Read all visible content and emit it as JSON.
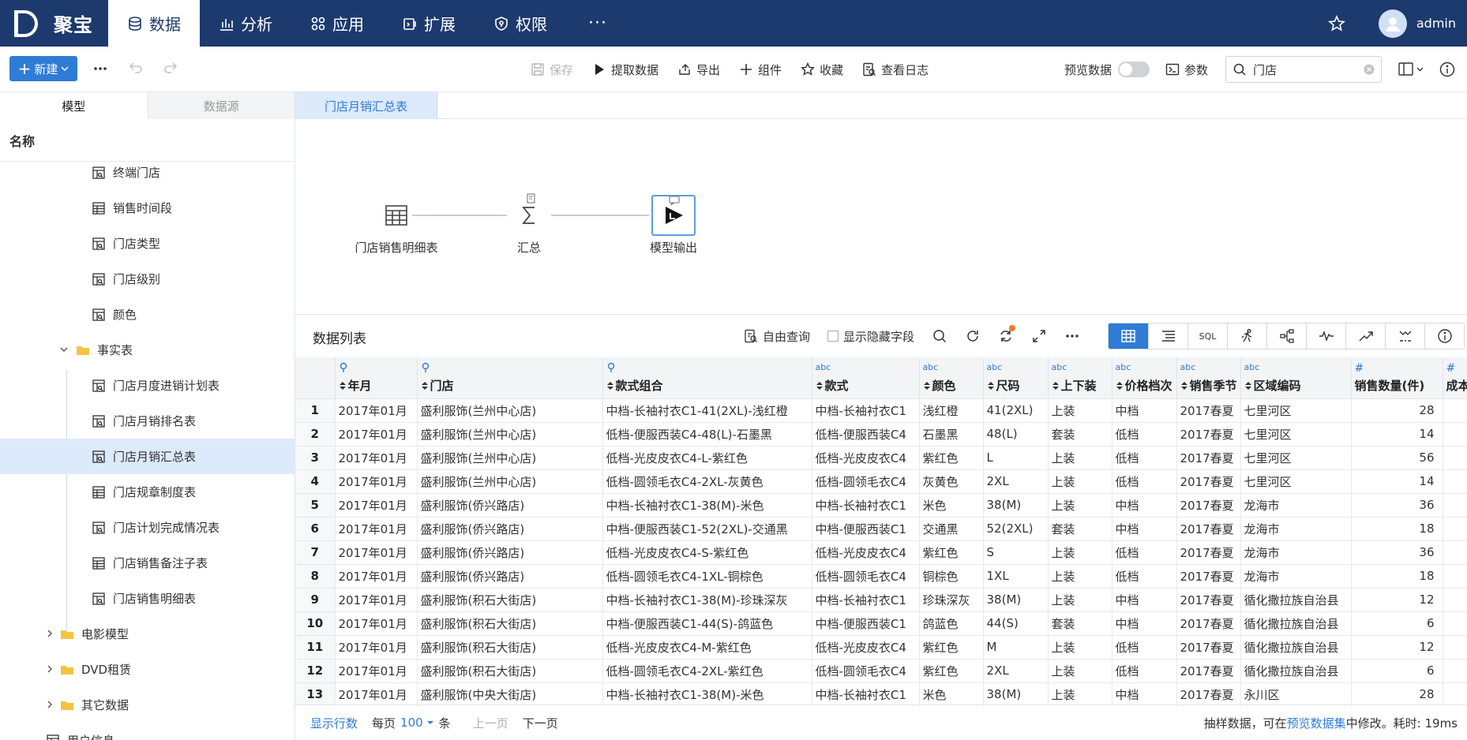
{
  "app": {
    "logo_letter": "D",
    "name": "聚宝",
    "user": "admin"
  },
  "nav": [
    {
      "label": "数据",
      "icon": "database-icon",
      "active": true
    },
    {
      "label": "分析",
      "icon": "bar-chart-icon"
    },
    {
      "label": "应用",
      "icon": "apps-icon"
    },
    {
      "label": "扩展",
      "icon": "extension-icon"
    },
    {
      "label": "权限",
      "icon": "shield-icon"
    },
    {
      "label": "···",
      "icon": "more-icon"
    }
  ],
  "toolbar": {
    "new_label": "新建",
    "save": "保存",
    "extract": "提取数据",
    "export": "导出",
    "component": "组件",
    "favorite": "收藏",
    "log": "查看日志",
    "preview_label": "预览数据",
    "params": "参数",
    "search_value": "门店"
  },
  "sidebar": {
    "tabs": [
      "模型",
      "数据源"
    ],
    "header": "名称",
    "items": [
      {
        "label": "终端门店",
        "icon": "table-model-icon"
      },
      {
        "label": "销售时间段",
        "icon": "table-icon"
      },
      {
        "label": "门店类型",
        "icon": "table-model-icon"
      },
      {
        "label": "门店级别",
        "icon": "table-model-icon"
      },
      {
        "label": "颜色",
        "icon": "table-model-icon"
      },
      {
        "label": "事实表",
        "icon": "folder-icon",
        "folder": true
      },
      {
        "label": "门店月度进销计划表",
        "icon": "table-model-icon"
      },
      {
        "label": "门店月销排名表",
        "icon": "table-model-icon"
      },
      {
        "label": "门店月销汇总表",
        "icon": "table-model-icon",
        "selected": true
      },
      {
        "label": "门店规章制度表",
        "icon": "table-icon"
      },
      {
        "label": "门店计划完成情况表",
        "icon": "table-model-icon"
      },
      {
        "label": "门店销售备注子表",
        "icon": "table-icon"
      },
      {
        "label": "门店销售明细表",
        "icon": "table-model-icon"
      },
      {
        "label": "电影模型",
        "icon": "folder-icon",
        "folder": true
      },
      {
        "label": "DVD租赁",
        "icon": "folder-icon",
        "folder": true
      },
      {
        "label": "其它数据",
        "icon": "folder-icon",
        "folder": true
      },
      {
        "label": "用户信息",
        "icon": "table-icon"
      }
    ]
  },
  "doc_tab": "门店月销汇总表",
  "flow": {
    "source": "门店销售明细表",
    "aggregate": "汇总",
    "output": "模型输出"
  },
  "datalist": {
    "title": "数据列表",
    "free_query": "自由查询",
    "show_hidden": "显示隐藏字段",
    "sql_label": "SQL"
  },
  "table": {
    "columns": [
      {
        "label": "年月",
        "type": "dim-icon"
      },
      {
        "label": "门店",
        "type": "dim-icon"
      },
      {
        "label": "款式组合",
        "type": "dim-icon"
      },
      {
        "label": "款式",
        "type": "abc"
      },
      {
        "label": "颜色",
        "type": "abc"
      },
      {
        "label": "尺码",
        "type": "abc"
      },
      {
        "label": "上下装",
        "type": "abc"
      },
      {
        "label": "价格档次",
        "type": "abc"
      },
      {
        "label": "销售季节",
        "type": "abc"
      },
      {
        "label": "区域编码",
        "type": "abc"
      },
      {
        "label": "销售数量(件)",
        "type": "#"
      },
      {
        "label": "成本",
        "type": "#"
      }
    ],
    "rows": [
      [
        "1",
        "2017年01月",
        "盛利服饰(兰州中心店)",
        "中档-长袖衬衣C1-41(2XL)-浅红橙",
        "中档-长袖衬衣C1",
        "浅红橙",
        "41(2XL)",
        "上装",
        "中档",
        "2017春夏",
        "七里河区",
        "28"
      ],
      [
        "2",
        "2017年01月",
        "盛利服饰(兰州中心店)",
        "低档-便服西装C4-48(L)-石墨黑",
        "低档-便服西装C4",
        "石墨黑",
        "48(L)",
        "套装",
        "低档",
        "2017春夏",
        "七里河区",
        "14"
      ],
      [
        "3",
        "2017年01月",
        "盛利服饰(兰州中心店)",
        "低档-光皮皮衣C4-L-紫红色",
        "低档-光皮皮衣C4",
        "紫红色",
        "L",
        "上装",
        "低档",
        "2017春夏",
        "七里河区",
        "56"
      ],
      [
        "4",
        "2017年01月",
        "盛利服饰(兰州中心店)",
        "低档-圆领毛衣C4-2XL-灰黄色",
        "低档-圆领毛衣C4",
        "灰黄色",
        "2XL",
        "上装",
        "低档",
        "2017春夏",
        "七里河区",
        "14"
      ],
      [
        "5",
        "2017年01月",
        "盛利服饰(侨兴路店)",
        "中档-长袖衬衣C1-38(M)-米色",
        "中档-长袖衬衣C1",
        "米色",
        "38(M)",
        "上装",
        "中档",
        "2017春夏",
        "龙海市",
        "36"
      ],
      [
        "6",
        "2017年01月",
        "盛利服饰(侨兴路店)",
        "中档-便服西装C1-52(2XL)-交通黑",
        "中档-便服西装C1",
        "交通黑",
        "52(2XL)",
        "套装",
        "中档",
        "2017春夏",
        "龙海市",
        "18"
      ],
      [
        "7",
        "2017年01月",
        "盛利服饰(侨兴路店)",
        "低档-光皮皮衣C4-S-紫红色",
        "低档-光皮皮衣C4",
        "紫红色",
        "S",
        "上装",
        "低档",
        "2017春夏",
        "龙海市",
        "36"
      ],
      [
        "8",
        "2017年01月",
        "盛利服饰(侨兴路店)",
        "低档-圆领毛衣C4-1XL-铜棕色",
        "低档-圆领毛衣C4",
        "铜棕色",
        "1XL",
        "上装",
        "低档",
        "2017春夏",
        "龙海市",
        "18"
      ],
      [
        "9",
        "2017年01月",
        "盛利服饰(积石大街店)",
        "中档-长袖衬衣C1-38(M)-珍珠深灰",
        "中档-长袖衬衣C1",
        "珍珠深灰",
        "38(M)",
        "上装",
        "中档",
        "2017春夏",
        "循化撒拉族自治县",
        "12"
      ],
      [
        "10",
        "2017年01月",
        "盛利服饰(积石大街店)",
        "中档-便服西装C1-44(S)-鸽蓝色",
        "中档-便服西装C1",
        "鸽蓝色",
        "44(S)",
        "套装",
        "中档",
        "2017春夏",
        "循化撒拉族自治县",
        "6"
      ],
      [
        "11",
        "2017年01月",
        "盛利服饰(积石大街店)",
        "低档-光皮皮衣C4-M-紫红色",
        "低档-光皮皮衣C4",
        "紫红色",
        "M",
        "上装",
        "低档",
        "2017春夏",
        "循化撒拉族自治县",
        "12"
      ],
      [
        "12",
        "2017年01月",
        "盛利服饰(积石大街店)",
        "低档-圆领毛衣C4-2XL-紫红色",
        "低档-圆领毛衣C4",
        "紫红色",
        "2XL",
        "上装",
        "低档",
        "2017春夏",
        "循化撒拉族自治县",
        "6"
      ],
      [
        "13",
        "2017年01月",
        "盛利服饰(中央大街店)",
        "中档-长袖衬衣C1-38(M)-米色",
        "中档-长袖衬衣C1",
        "米色",
        "38(M)",
        "上装",
        "中档",
        "2017春夏",
        "永川区",
        "28"
      ]
    ]
  },
  "footer": {
    "show_rows": "显示行数",
    "per_page": "每页",
    "page_size": "100",
    "unit": "条",
    "prev": "上一页",
    "next": "下一页",
    "note_prefix": "抽样数据，可在",
    "note_link": "预览数据集",
    "note_suffix": "中修改。耗时: 19ms"
  },
  "colors": {
    "nav_bg": "#1d3a6e",
    "accent": "#2f7cd6",
    "selected_bg": "#dceafb"
  }
}
